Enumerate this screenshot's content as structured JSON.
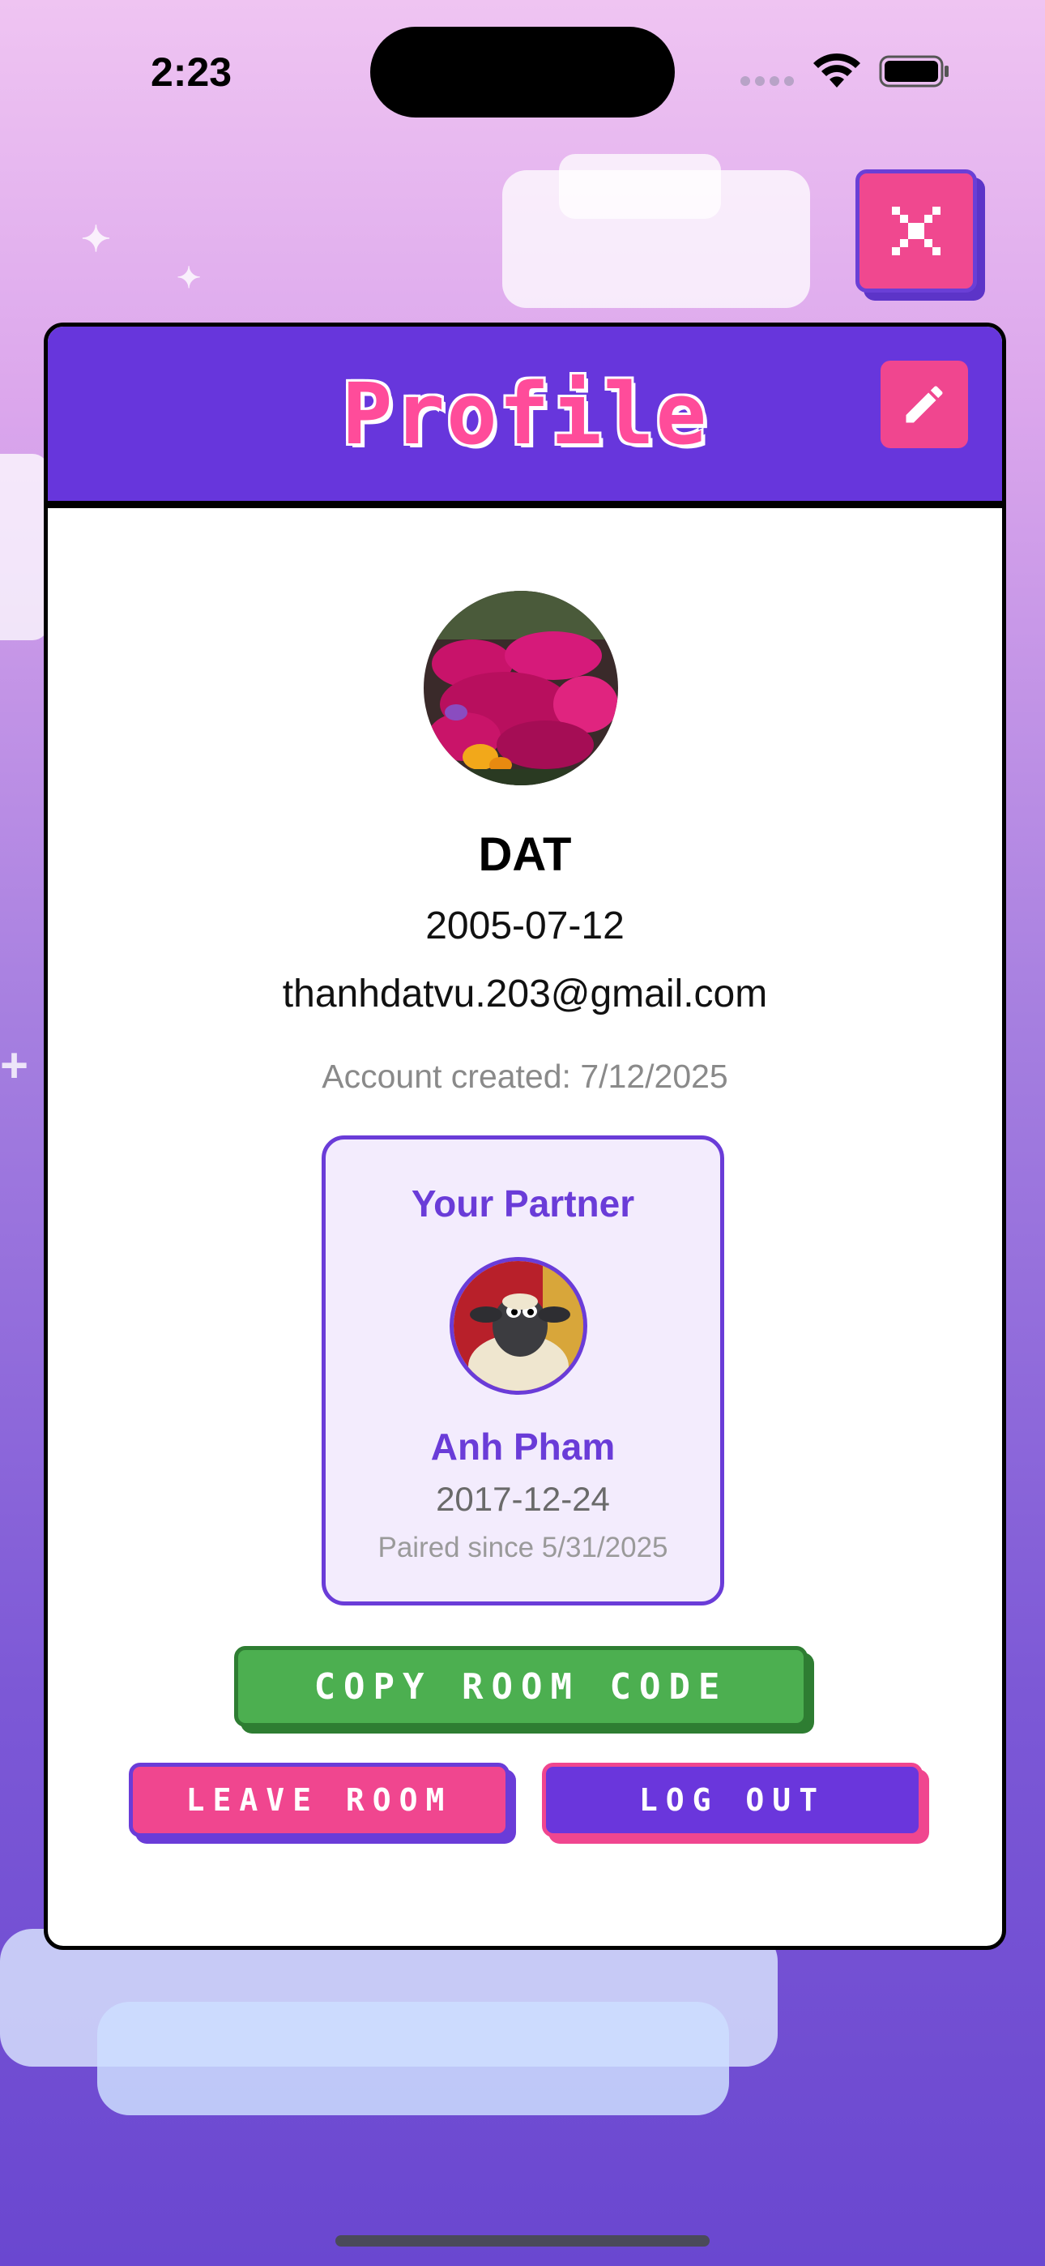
{
  "status_bar": {
    "time": "2:23"
  },
  "close": {
    "icon": "close-icon"
  },
  "header": {
    "title": "Profile",
    "edit_icon": "pencil-icon"
  },
  "profile": {
    "name": "DAT",
    "dob": "2005-07-12",
    "email": "thanhdatvu.203@gmail.com",
    "created": "Account created: 7/12/2025"
  },
  "partner": {
    "title": "Your Partner",
    "name": "Anh Pham",
    "dob": "2017-12-24",
    "since": "Paired since 5/31/2025"
  },
  "buttons": {
    "copy": "COPY ROOM CODE",
    "leave": "LEAVE ROOM",
    "logout": "LOG OUT"
  },
  "colors": {
    "primary": "#6736dc",
    "accent": "#f0468f",
    "success": "#4caf50"
  }
}
